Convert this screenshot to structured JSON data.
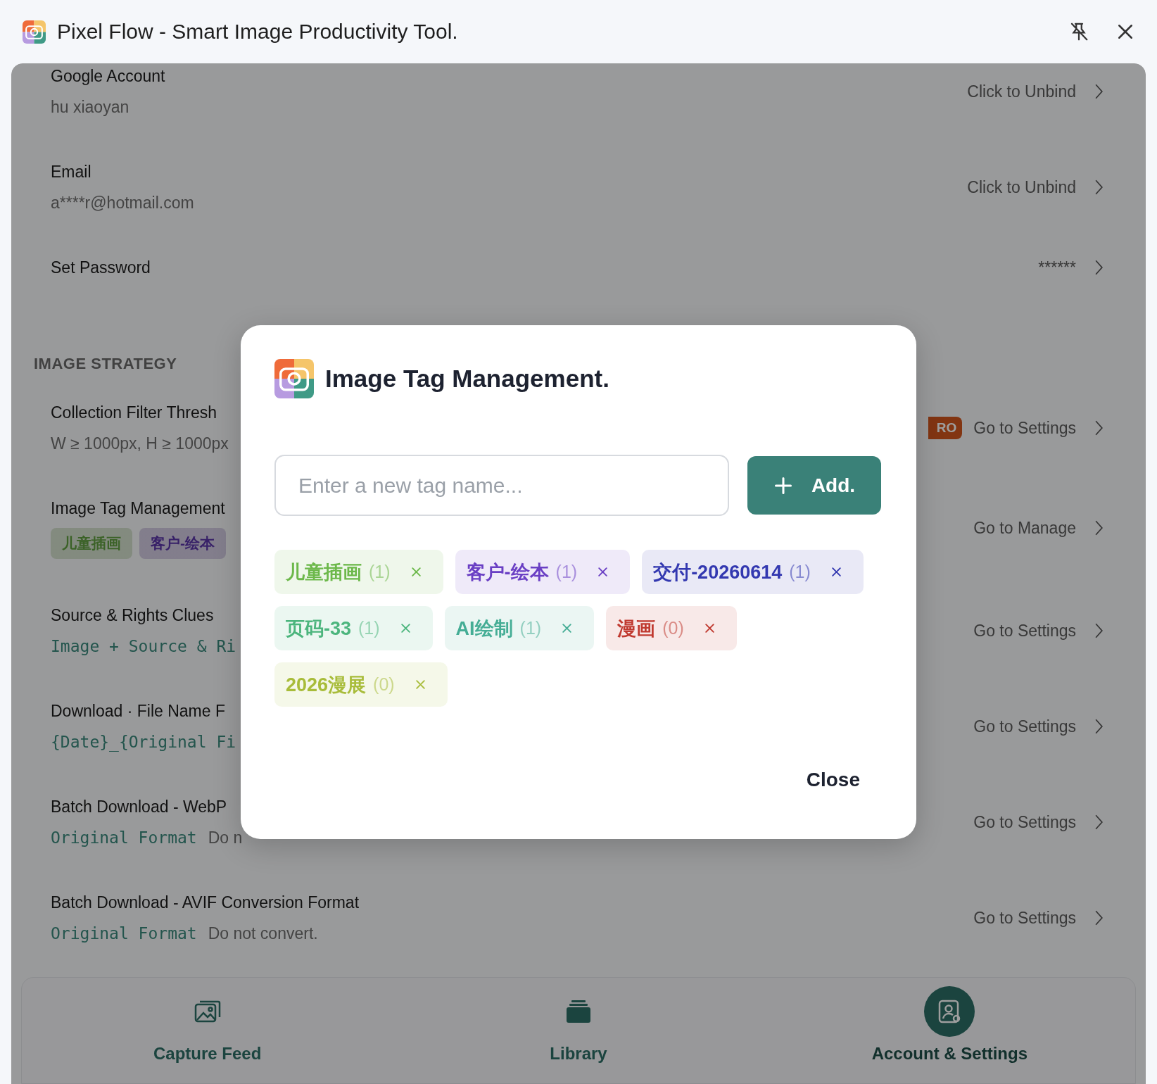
{
  "window": {
    "title": "Pixel Flow - Smart Image Productivity Tool."
  },
  "account_rows": [
    {
      "label": "Google Account",
      "value": "hu xiaoyan",
      "kind": "plain",
      "action": "Click to Unbind"
    },
    {
      "label": "Email",
      "value": "a****r@hotmail.com",
      "kind": "plain",
      "action": "Click to Unbind"
    },
    {
      "label": "Set Password",
      "action": "******"
    }
  ],
  "strategy": {
    "heading": "IMAGE STRATEGY",
    "rows": [
      {
        "label": "Collection Filter Thresh",
        "value": "W ≥ 1000px, H ≥ 1000px",
        "kind": "plain",
        "badge": "RO",
        "action": "Go to Settings"
      },
      {
        "label": "Image Tag Management",
        "tags": [
          {
            "name": "儿童插画",
            "color": "#3b6227"
          },
          {
            "name": "客户-绘本",
            "color": "#382168"
          }
        ],
        "action": "Go to Manage"
      },
      {
        "label": "Source & Rights Clues",
        "value": "Image + Source & Ri",
        "kind": "code",
        "action": "Go to Settings"
      },
      {
        "label": "Download · File Name F",
        "value": "{Date}_{Original Fi",
        "kind": "code",
        "action": "Go to Settings"
      },
      {
        "label": "Batch Download - WebP",
        "value": "Original Format",
        "kind": "code",
        "note": "Do n",
        "action": "Go to Settings"
      },
      {
        "label": "Batch Download - AVIF Conversion Format",
        "value": "Original Format",
        "kind": "code",
        "note": "Do not convert.",
        "action": "Go to Settings"
      }
    ]
  },
  "nav": [
    {
      "label": "Capture Feed",
      "selected": false
    },
    {
      "label": "Library",
      "selected": false
    },
    {
      "label": "Account & Settings",
      "selected": true
    }
  ],
  "dialog": {
    "title": "Image Tag Management.",
    "input": {
      "placeholder": "Enter a new tag name..."
    },
    "add_button": "Add.",
    "tags": [
      {
        "name": "儿童插画",
        "count": "(1)",
        "color": "#6cb84a"
      },
      {
        "name": "客户-绘本",
        "count": "(1)",
        "color": "#6a3fc4"
      },
      {
        "name": "交付-20260614",
        "count": "(1)",
        "color": "#3338b0"
      },
      {
        "name": "页码-33",
        "count": "(1)",
        "color": "#4cb57d"
      },
      {
        "name": "AI绘制",
        "count": "(1)",
        "color": "#45ad95"
      },
      {
        "name": "漫画",
        "count": "(0)",
        "color": "#c03a30"
      },
      {
        "name": "2026漫展",
        "count": "(0)",
        "color": "#a8bc3a"
      }
    ],
    "close_button": "Close"
  }
}
